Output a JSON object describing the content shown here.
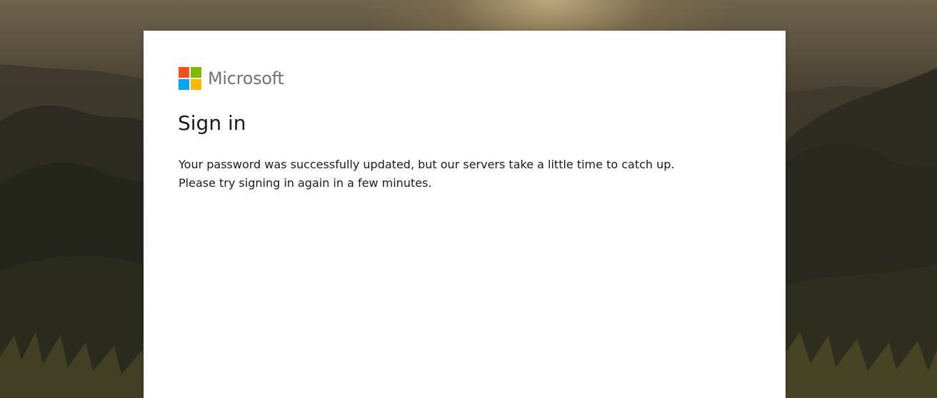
{
  "brand": {
    "name": "Microsoft",
    "logo_colors": [
      "#f25022",
      "#7fba00",
      "#00a4ef",
      "#ffb900"
    ]
  },
  "page": {
    "title": "Sign in",
    "message_lines": [
      "Your password was successfully updated, but our servers take a little time to catch up.",
      "Please try signing in again in a few minutes."
    ]
  }
}
